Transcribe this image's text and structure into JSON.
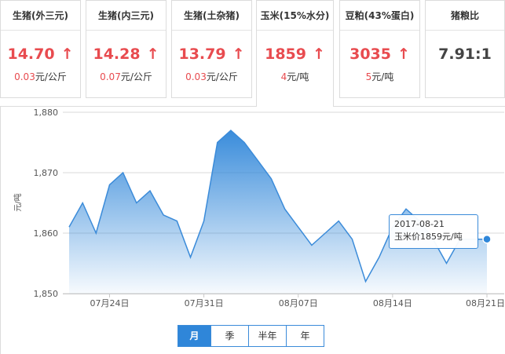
{
  "cards": [
    {
      "title": "生猪(外三元)",
      "price": "14.70",
      "arrow": "↑",
      "change": "0.03",
      "unit": "元/公斤"
    },
    {
      "title": "生猪(内三元)",
      "price": "14.28",
      "arrow": "↑",
      "change": "0.07",
      "unit": "元/公斤"
    },
    {
      "title": "生猪(土杂猪)",
      "price": "13.79",
      "arrow": "↑",
      "change": "0.03",
      "unit": "元/公斤"
    },
    {
      "title": "玉米(15%水分)",
      "price": "1859",
      "arrow": "↑",
      "change": "4",
      "unit": "元/吨"
    },
    {
      "title": "豆粕(43%蛋白)",
      "price": "3035",
      "arrow": "↑",
      "change": "5",
      "unit": "元/吨"
    },
    {
      "title": "猪粮比",
      "price": "7.91:1",
      "arrow": "",
      "change": "",
      "unit": ""
    }
  ],
  "active_card_index": 3,
  "colors": {
    "up": "#e84b4f",
    "accent": "#3b8bd9",
    "line": "#2f86d9"
  },
  "chart_data": {
    "type": "area",
    "ylabel": "元/吨",
    "ylim": [
      1850,
      1880
    ],
    "yticks": [
      1850,
      1860,
      1870,
      1880
    ],
    "ytick_labels": [
      "1,850",
      "1,860",
      "1,870",
      "1,880"
    ],
    "xlim": [
      0,
      31
    ],
    "xticks": [
      {
        "x": 3,
        "label": "07月24日"
      },
      {
        "x": 10,
        "label": "07月31日"
      },
      {
        "x": 17,
        "label": "08月07日"
      },
      {
        "x": 24,
        "label": "08月14日"
      },
      {
        "x": 31,
        "label": "08月21日"
      }
    ],
    "x": [
      0,
      1,
      2,
      3,
      4,
      5,
      6,
      7,
      8,
      9,
      10,
      11,
      12,
      13,
      14,
      15,
      16,
      17,
      18,
      19,
      20,
      21,
      22,
      23,
      24,
      25,
      26,
      27,
      28,
      29,
      30,
      31
    ],
    "values": [
      1861,
      1865,
      1860,
      1868,
      1870,
      1865,
      1867,
      1863,
      1862,
      1856,
      1862,
      1875,
      1877,
      1875,
      1872,
      1869,
      1864,
      1861,
      1858,
      1860,
      1862,
      1859,
      1852,
      1856,
      1861,
      1864,
      1862,
      1859,
      1855,
      1859,
      1859,
      1859
    ],
    "grid": true,
    "highlight": {
      "index": 31
    }
  },
  "tooltip": {
    "date": "2017-08-21",
    "text": "玉米价1859元/吨"
  },
  "range_buttons": [
    {
      "label": "月",
      "selected": true
    },
    {
      "label": "季",
      "selected": false
    },
    {
      "label": "半年",
      "selected": false
    },
    {
      "label": "年",
      "selected": false
    }
  ]
}
